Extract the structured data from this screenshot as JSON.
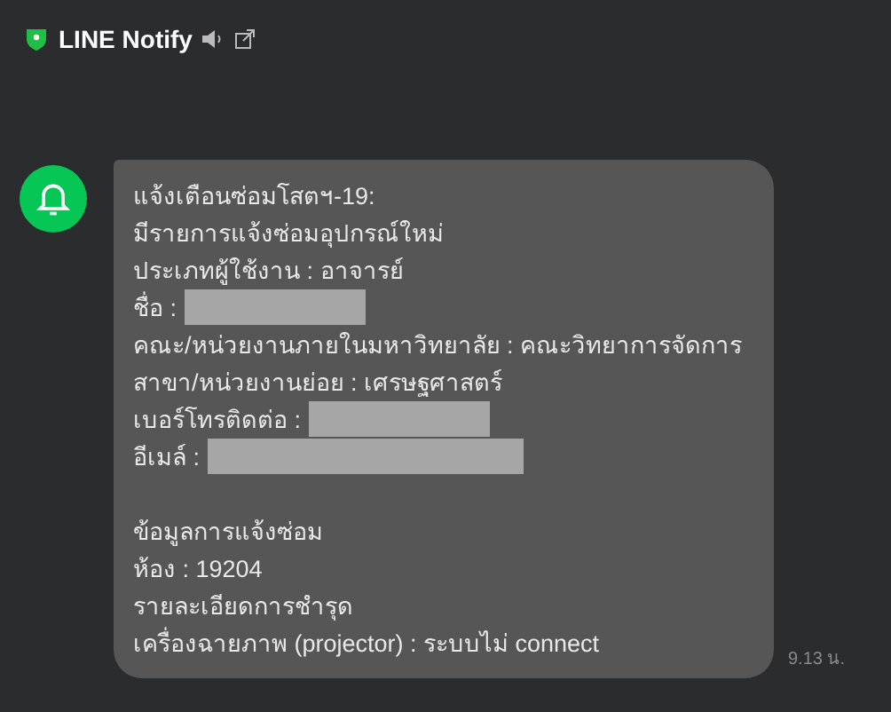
{
  "header": {
    "title": "LINE Notify"
  },
  "message": {
    "paragraphs": [
      [
        {
          "text": "แจ้งเตือนซ่อมโสตฯ-19:",
          "redacted": false
        },
        {
          "text": "มีรายการแจ้งซ่อมอุปกรณ์ใหม่",
          "redacted": false
        },
        {
          "text": "ประเภทผู้ใช้งาน : อาจารย์",
          "redacted": false
        },
        {
          "text": "ชื่อ :",
          "redacted": true
        },
        {
          "text": "คณะ/หน่วยงานภายในมหาวิทยาลัย : คณะวิทยาการจัดการ",
          "redacted": false
        },
        {
          "text": "สาขา/หน่วยงานย่อย : เศรษฐศาสตร์",
          "redacted": false
        },
        {
          "text": "เบอร์โทรติดต่อ :",
          "redacted": true
        },
        {
          "text": "อีเมล์ :",
          "redacted": true
        }
      ],
      [
        {
          "text": "ข้อมูลการแจ้งซ่อม",
          "redacted": false
        },
        {
          "text": "ห้อง : 19204",
          "redacted": false
        },
        {
          "text": "รายละเอียดการชำรุด",
          "redacted": false
        },
        {
          "text": "เครื่องฉายภาพ (projector) : ระบบไม่ connect",
          "redacted": false
        }
      ]
    ],
    "time": "9.13 น."
  }
}
